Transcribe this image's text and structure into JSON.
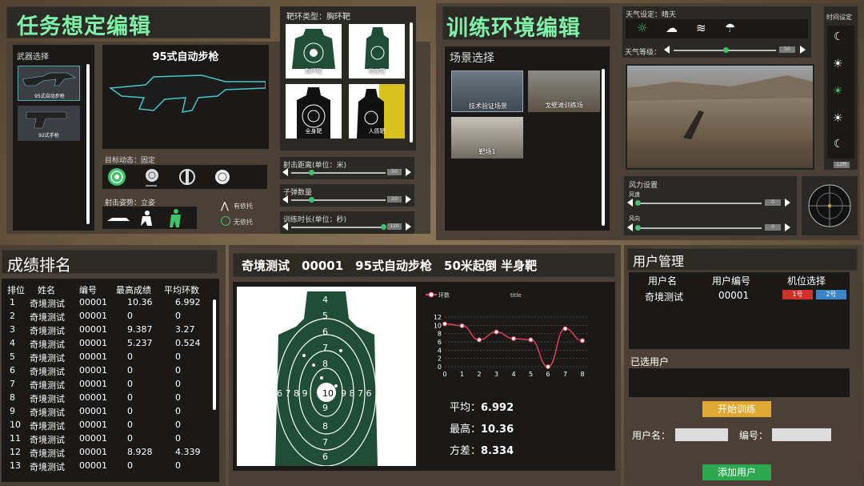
{
  "mission": {
    "title": "任务想定编辑",
    "weapon_select": "武器选择",
    "weapons": [
      {
        "name": "95式自动步枪"
      },
      {
        "name": "92式手枪"
      }
    ],
    "weapon_main": "95式自动步枪",
    "target_motion": "目标动态：固定",
    "shoot_pose": "射击姿势：立姿",
    "support_yes": "有依托",
    "support_no": "无依托"
  },
  "target": {
    "type_label": "靶环类型：胸环靶",
    "targets": [
      "胸环靶",
      "侧身靶",
      "全身靶",
      "人质靶"
    ],
    "distance_label": "射击距离(单位：米)",
    "distance_value": "50",
    "ammo_label": "子弹数量",
    "ammo_value": "10",
    "duration_label": "训练时长(单位：秒)",
    "duration_value": "120"
  },
  "env": {
    "title": "训练环境编辑",
    "scene_select": "场景选择",
    "scenes": [
      "技术验证场景",
      "戈壁滩训练场",
      "靶场1"
    ],
    "weather_label": "天气设定：晴天",
    "weather_level_label": "天气等级：",
    "weather_level_value": "50",
    "time_label": "时间设定",
    "time_value": "12时",
    "wind_label": "风力设置",
    "wind_speed_label": "风速",
    "wind_speed_value": "0",
    "wind_dir_label": "风向",
    "wind_dir_value": "0",
    "accent": "#3ec26a"
  },
  "ranking": {
    "title": "成绩排名",
    "headers": [
      "排位",
      "姓名",
      "编号",
      "最高成绩",
      "平均环数"
    ],
    "rows": [
      [
        "1",
        "奇境测试",
        "00001",
        "10.36",
        "6.992"
      ],
      [
        "2",
        "奇境测试",
        "00001",
        "0",
        "0"
      ],
      [
        "3",
        "奇境测试",
        "00001",
        "9.387",
        "3.27"
      ],
      [
        "4",
        "奇境测试",
        "00001",
        "5.237",
        "0.524"
      ],
      [
        "5",
        "奇境测试",
        "00001",
        "0",
        "0"
      ],
      [
        "6",
        "奇境测试",
        "00001",
        "0",
        "0"
      ],
      [
        "7",
        "奇境测试",
        "00001",
        "0",
        "0"
      ],
      [
        "8",
        "奇境测试",
        "00001",
        "0",
        "0"
      ],
      [
        "9",
        "奇境测试",
        "00001",
        "0",
        "0"
      ],
      [
        "10",
        "奇境测试",
        "00001",
        "0",
        "0"
      ],
      [
        "11",
        "奇境测试",
        "00001",
        "0",
        "0"
      ],
      [
        "12",
        "奇境测试",
        "00001",
        "8.928",
        "4.339"
      ],
      [
        "13",
        "奇境测试",
        "00001",
        "0",
        "0"
      ]
    ]
  },
  "result": {
    "header": "奇境测试　00001　95式自动步枪　50米起倒 半身靶",
    "avg_label": "平均：",
    "avg": "6.992",
    "max_label": "最高：",
    "max": "10.36",
    "var_label": "方差：",
    "var": "8.334"
  },
  "chart_data": {
    "type": "line",
    "title": "title",
    "legend": "环数",
    "x": [
      0,
      1,
      2,
      3,
      4,
      5,
      6,
      7,
      8
    ],
    "values": [
      10.36,
      9.9,
      6.5,
      8.4,
      6.8,
      6.5,
      0,
      9.2,
      6.3
    ],
    "ylim": [
      0,
      12
    ],
    "yticks": [
      0,
      2,
      4,
      6,
      8,
      10,
      12
    ],
    "color": "#e0405a"
  },
  "users": {
    "title": "用户管理",
    "headers": [
      "用户名",
      "用户编号",
      "机位选择"
    ],
    "row": {
      "name": "奇境测试",
      "id": "00001",
      "slot1": "1号",
      "slot2": "2号"
    },
    "selected_label": "已选用户",
    "start_button": "开始训练",
    "username_label": "用户名：",
    "id_label": "编号：",
    "username_placeholder": "",
    "id_placeholder": "",
    "add_button": "添加用户"
  }
}
